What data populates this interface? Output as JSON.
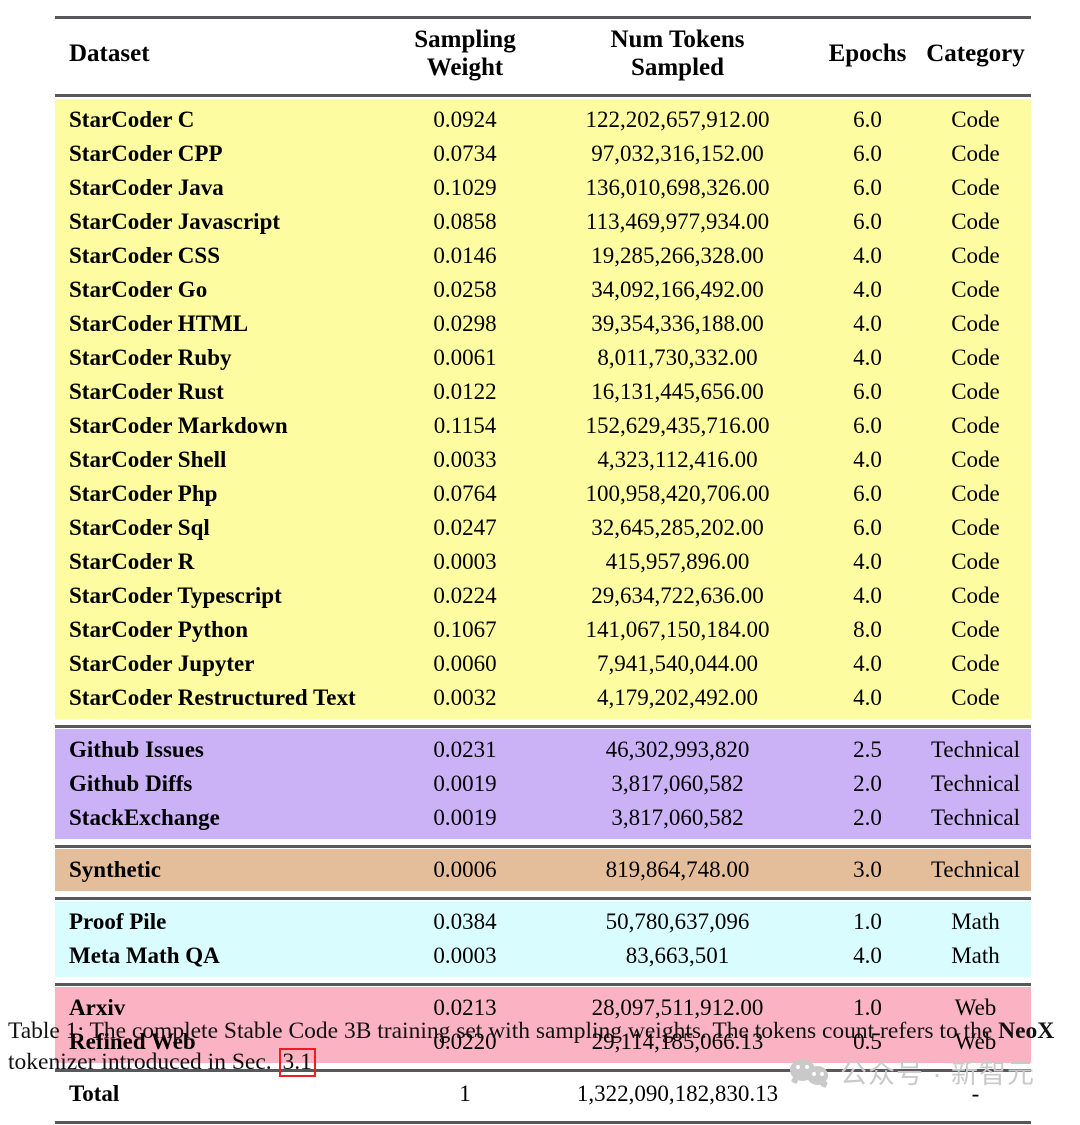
{
  "table": {
    "columns": [
      "Dataset",
      "Sampling Weight",
      "Num Tokens Sampled",
      "Epochs",
      "Category"
    ],
    "headers": {
      "dataset": "Dataset",
      "weight_l1": "Sampling",
      "weight_l2": "Weight",
      "tokens_l1": "Num Tokens",
      "tokens_l2": "Sampled",
      "epochs": "Epochs",
      "category": "Category"
    },
    "sections": [
      {
        "id": "code",
        "color": "#fdfca0",
        "rows": [
          {
            "dataset": "StarCoder C",
            "weight": "0.0924",
            "tokens": "122,202,657,912.00",
            "epochs": "6.0",
            "category": "Code"
          },
          {
            "dataset": "StarCoder CPP",
            "weight": "0.0734",
            "tokens": "97,032,316,152.00",
            "epochs": "6.0",
            "category": "Code"
          },
          {
            "dataset": "StarCoder Java",
            "weight": "0.1029",
            "tokens": "136,010,698,326.00",
            "epochs": "6.0",
            "category": "Code"
          },
          {
            "dataset": "StarCoder Javascript",
            "weight": "0.0858",
            "tokens": "113,469,977,934.00",
            "epochs": "6.0",
            "category": "Code"
          },
          {
            "dataset": "StarCoder CSS",
            "weight": "0.0146",
            "tokens": "19,285,266,328.00",
            "epochs": "4.0",
            "category": "Code"
          },
          {
            "dataset": "StarCoder Go",
            "weight": "0.0258",
            "tokens": "34,092,166,492.00",
            "epochs": "4.0",
            "category": "Code"
          },
          {
            "dataset": "StarCoder HTML",
            "weight": "0.0298",
            "tokens": "39,354,336,188.00",
            "epochs": "4.0",
            "category": "Code"
          },
          {
            "dataset": "StarCoder Ruby",
            "weight": "0.0061",
            "tokens": "8,011,730,332.00",
            "epochs": "4.0",
            "category": "Code"
          },
          {
            "dataset": "StarCoder Rust",
            "weight": "0.0122",
            "tokens": "16,131,445,656.00",
            "epochs": "6.0",
            "category": "Code"
          },
          {
            "dataset": "StarCoder Markdown",
            "weight": "0.1154",
            "tokens": "152,629,435,716.00",
            "epochs": "6.0",
            "category": "Code"
          },
          {
            "dataset": "StarCoder Shell",
            "weight": "0.0033",
            "tokens": "4,323,112,416.00",
            "epochs": "4.0",
            "category": "Code"
          },
          {
            "dataset": "StarCoder Php",
            "weight": "0.0764",
            "tokens": "100,958,420,706.00",
            "epochs": "6.0",
            "category": "Code"
          },
          {
            "dataset": "StarCoder Sql",
            "weight": "0.0247",
            "tokens": "32,645,285,202.00",
            "epochs": "6.0",
            "category": "Code"
          },
          {
            "dataset": "StarCoder R",
            "weight": "0.0003",
            "tokens": "415,957,896.00",
            "epochs": "4.0",
            "category": "Code"
          },
          {
            "dataset": "StarCoder Typescript",
            "weight": "0.0224",
            "tokens": "29,634,722,636.00",
            "epochs": "4.0",
            "category": "Code"
          },
          {
            "dataset": "StarCoder Python",
            "weight": "0.1067",
            "tokens": "141,067,150,184.00",
            "epochs": "8.0",
            "category": "Code"
          },
          {
            "dataset": "StarCoder Jupyter",
            "weight": "0.0060",
            "tokens": "7,941,540,044.00",
            "epochs": "4.0",
            "category": "Code"
          },
          {
            "dataset": "StarCoder Restructured Text",
            "weight": "0.0032",
            "tokens": "4,179,202,492.00",
            "epochs": "4.0",
            "category": "Code"
          }
        ]
      },
      {
        "id": "technical",
        "color": "#cbb2f7",
        "rows": [
          {
            "dataset": "Github Issues",
            "weight": "0.0231",
            "tokens": "46,302,993,820",
            "epochs": "2.5",
            "category": "Technical"
          },
          {
            "dataset": "Github Diffs",
            "weight": "0.0019",
            "tokens": "3,817,060,582",
            "epochs": "2.0",
            "category": "Technical"
          },
          {
            "dataset": "StackExchange",
            "weight": "0.0019",
            "tokens": "3,817,060,582",
            "epochs": "2.0",
            "category": "Technical"
          }
        ]
      },
      {
        "id": "synthetic",
        "color": "#e4be9b",
        "rows": [
          {
            "dataset": "Synthetic",
            "weight": "0.0006",
            "tokens": "819,864,748.00",
            "epochs": "3.0",
            "category": "Technical"
          }
        ]
      },
      {
        "id": "math",
        "color": "#d9fcff",
        "rows": [
          {
            "dataset": "Proof Pile",
            "weight": "0.0384",
            "tokens": "50,780,637,096",
            "epochs": "1.0",
            "category": "Math"
          },
          {
            "dataset": "Meta Math QA",
            "weight": "0.0003",
            "tokens": "83,663,501",
            "epochs": "4.0",
            "category": "Math"
          }
        ]
      },
      {
        "id": "web",
        "color": "#fbb2c2",
        "rows": [
          {
            "dataset": "Arxiv",
            "weight": "0.0213",
            "tokens": "28,097,511,912.00",
            "epochs": "1.0",
            "category": "Web"
          },
          {
            "dataset": "Refined Web",
            "weight": "0.0220",
            "tokens": "29,114,185,066.13",
            "epochs": "0.5",
            "category": "Web"
          }
        ]
      },
      {
        "id": "total",
        "color": "#ffffff",
        "rows": [
          {
            "dataset": "Total",
            "weight": "1",
            "tokens": "1,322,090,182,830.13",
            "epochs": "",
            "category": "-"
          }
        ]
      }
    ]
  },
  "caption": {
    "part1": "Table 1: The complete Stable Code 3B training set with sampling weights. The tokens count refers to the ",
    "bold": "NeoX",
    "part2": " tokenizer introduced in Sec.",
    "section_ref": "3.1"
  },
  "watermark": {
    "text": "公众号 · 新智元",
    "icon": "wechat-icon",
    "color": "#c9c9c9"
  }
}
